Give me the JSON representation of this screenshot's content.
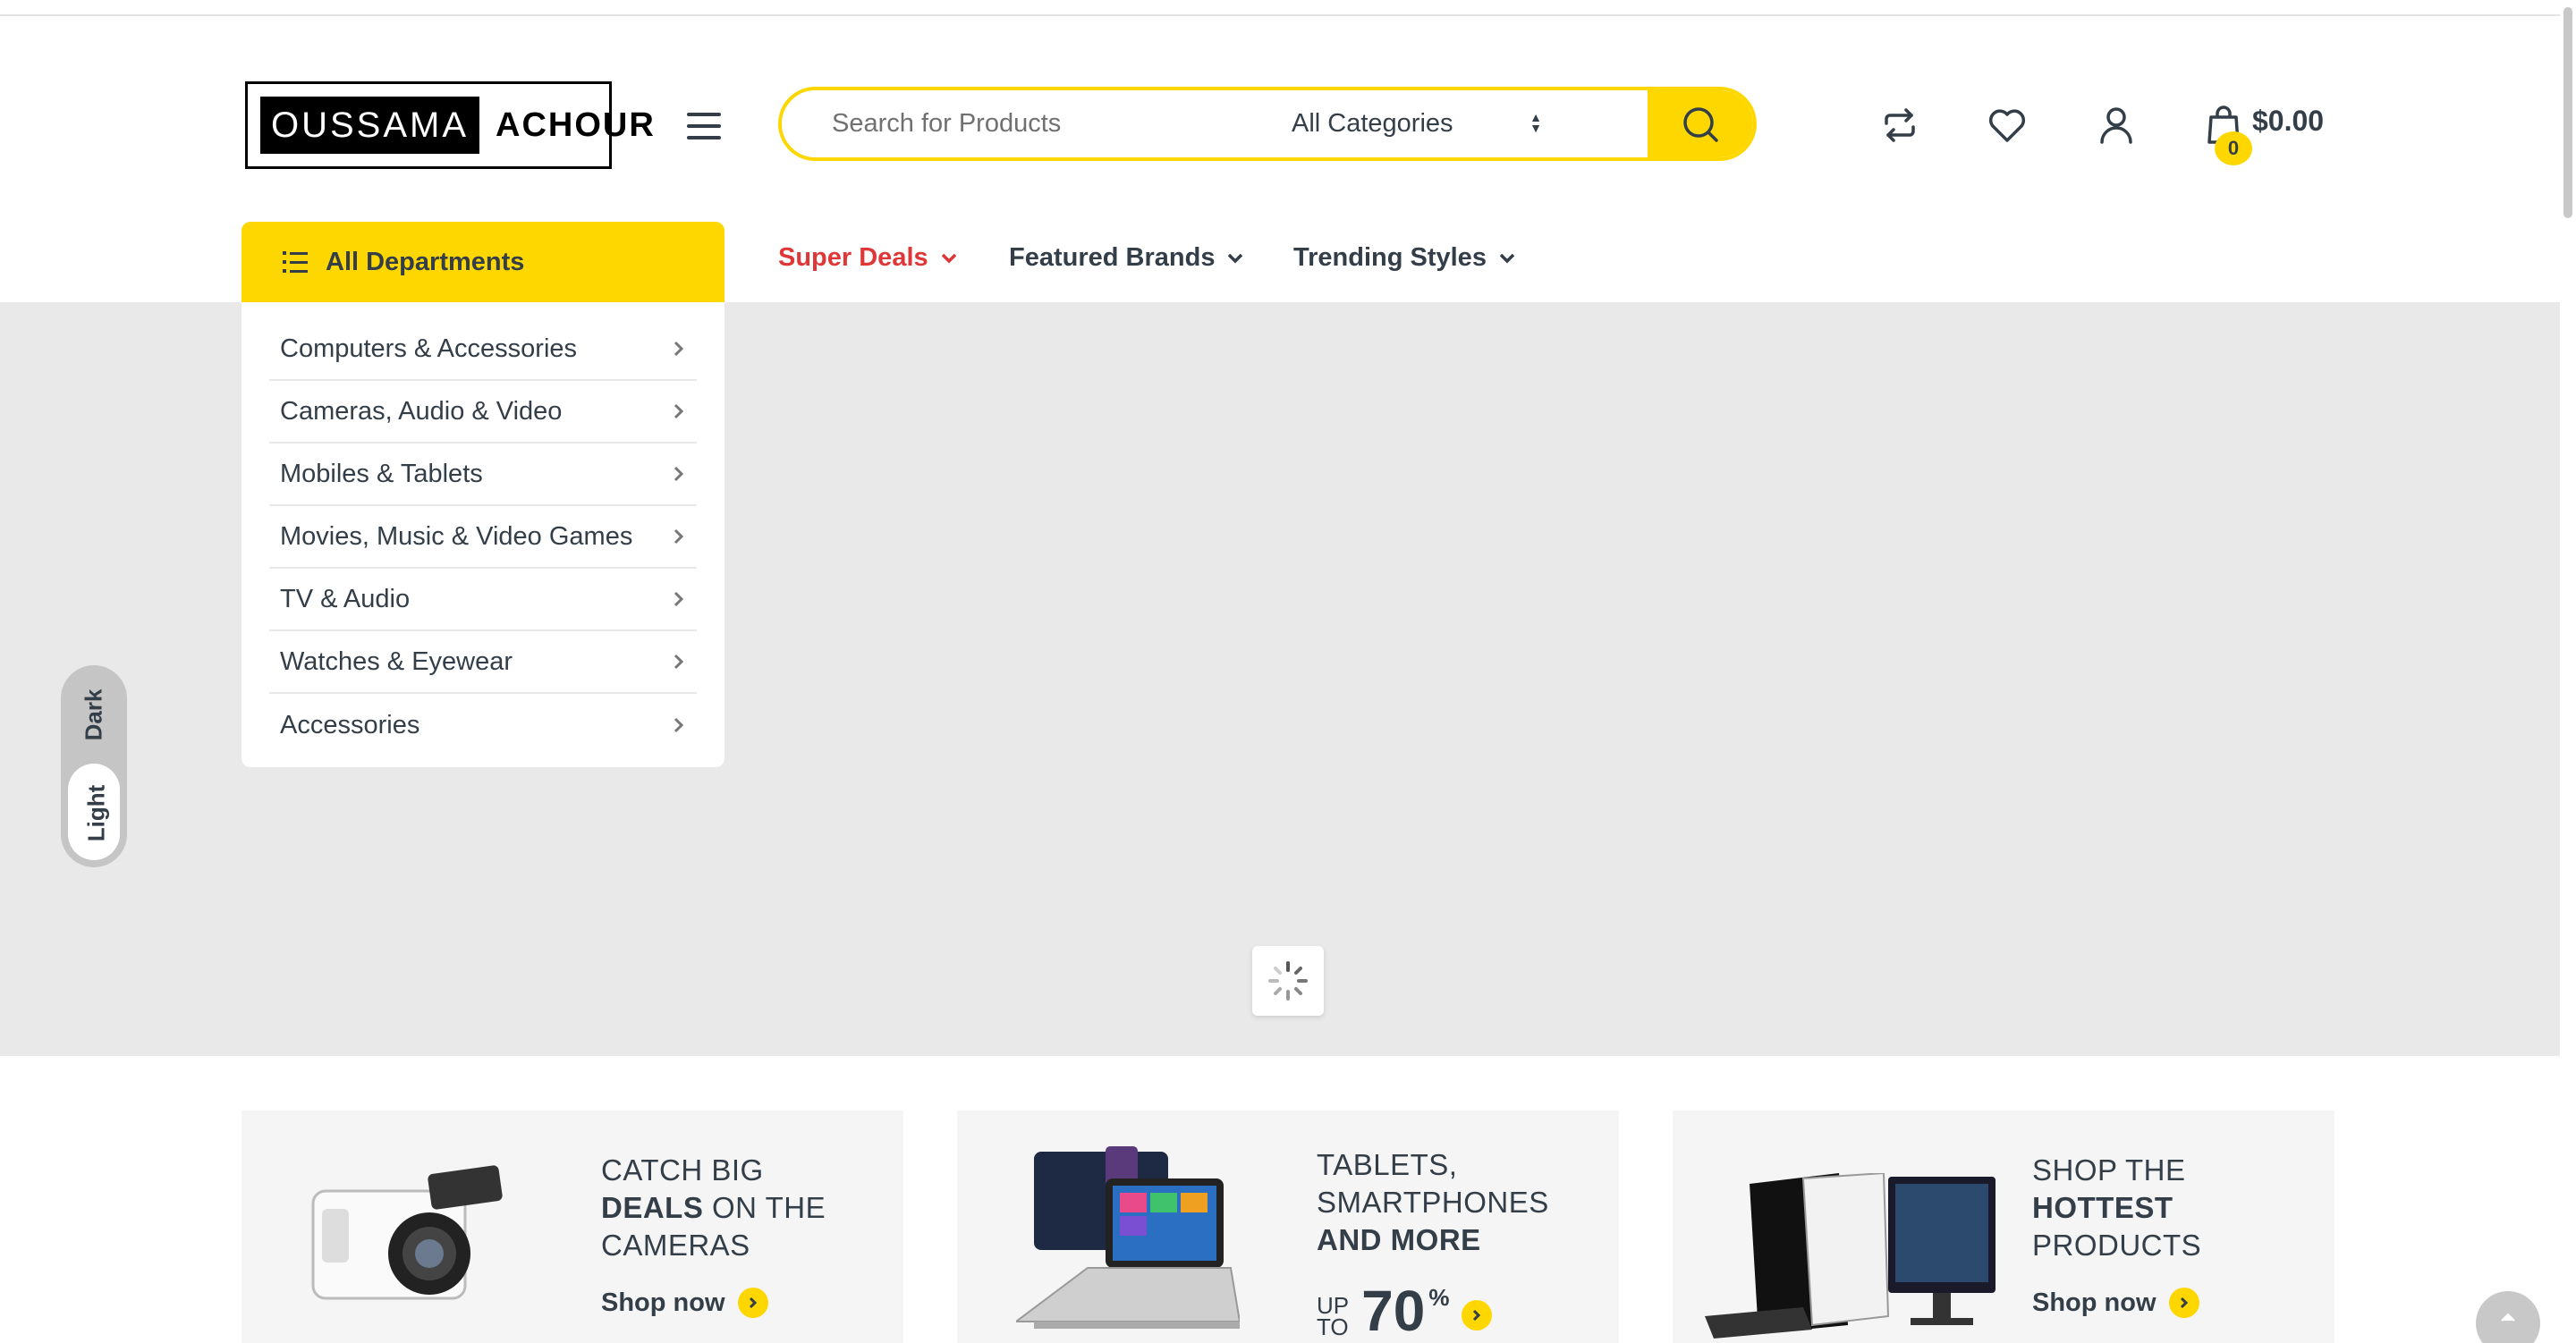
{
  "header": {
    "logo": {
      "part1": "OUSSAMA",
      "part2": "ACHOUR"
    },
    "search": {
      "placeholder": "Search for Products",
      "category": "All Categories"
    },
    "icons": [
      "compare-icon",
      "heart-icon",
      "user-icon",
      "shopping-bag-icon"
    ],
    "cart": {
      "count": "0",
      "total": "$0.00"
    }
  },
  "nav": {
    "departments_label": "All Departments",
    "items": [
      {
        "label": "Super Deals",
        "color": "#df3737"
      },
      {
        "label": "Featured Brands"
      },
      {
        "label": "Trending Styles"
      }
    ]
  },
  "departments": [
    "Computers & Accessories",
    "Cameras, Audio & Video",
    "Mobiles & Tablets",
    "Movies, Music & Video Games",
    "TV & Audio",
    "Watches & Eyewear",
    "Accessories"
  ],
  "theme_toggle": {
    "dark": "Dark",
    "light": "Light",
    "selected": "Light"
  },
  "promos": [
    {
      "line1": "CATCH BIG",
      "bold": "DEALS",
      "line2_rest": " ON THE",
      "line3": "CAMERAS",
      "cta": "Shop now"
    },
    {
      "line1": "TABLETS,",
      "line2": "SMARTPHONES",
      "bold": "AND MORE",
      "upto_1": "UP",
      "upto_2": "TO",
      "percent": "70",
      "pct_sign": "%"
    },
    {
      "line1": "SHOP THE",
      "bold": "HOTTEST",
      "line3": "PRODUCTS",
      "cta": "Shop now"
    }
  ],
  "colors": {
    "accent": "#fed700",
    "text": "#333e48",
    "deal": "#df3737",
    "hero_bg": "#e9e9e9"
  }
}
